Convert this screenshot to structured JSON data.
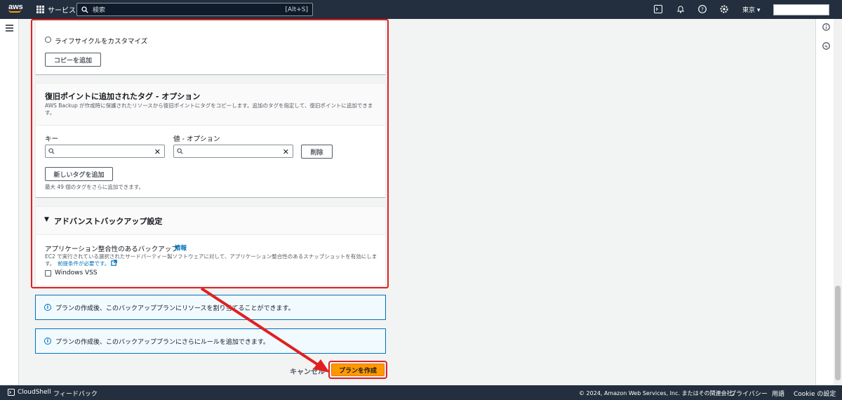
{
  "topnav": {
    "logo": "aws",
    "services_label": "サービス",
    "search_placeholder": "検索",
    "search_shortcut": "[Alt+S]",
    "region": "東京 ▾",
    "icons": [
      "cloudshell-icon",
      "bell-icon",
      "help-icon",
      "settings-icon"
    ]
  },
  "lifecycle": {
    "radio_label": "ライフサイクルをカスタマイズ",
    "add_copy_button": "コピーを追加"
  },
  "tags": {
    "heading": "復旧ポイントに追加されたタグ - オプション",
    "description": "AWS Backup が作成時に保護されたリソースから復旧ポイントにタグをコピーします。追加のタグを指定して、復旧ポイントに追加できま す。",
    "key_label": "キー",
    "value_label": "値 - オプション",
    "key_value": "",
    "value_value": "",
    "remove_button": "削除",
    "add_tag_button": "新しいタグを追加",
    "remaining_note": "最大 49 個のタグをさらに追加できます。"
  },
  "advanced": {
    "heading": "アドバンストバックアップ設定",
    "option_label": "アプリケーション整合性のあるバックアップ",
    "info_link": "情報",
    "description_line1": "EC2 で実行されている選択されたサードパーティー製ソフトウェアに対して、アプリケーション整合性のあるスナップショットを有効にしま",
    "description_line2": "す。",
    "prereq_link": "前提条件が必要です。",
    "checkbox_label": "Windows VSS"
  },
  "alerts": {
    "resources": "プランの作成後、このバックアッププランにリソースを割り当てることができます。",
    "rules": "プランの作成後、このバックアッププランにさらにルールを追加できます。"
  },
  "actions": {
    "cancel": "キャンセル",
    "create": "プランを作成"
  },
  "footer": {
    "cloudshell": "CloudShell",
    "feedback": "フィードバック",
    "copyright": "© 2024, Amazon Web Services, Inc. またはその関連会社。",
    "privacy": "プライバシー",
    "terms": "用語",
    "cookie": "Cookie の設定"
  },
  "colors": {
    "nav_bg": "#232f3e",
    "primary": "#ff9900",
    "link": "#0073bb",
    "highlight": "#e02020"
  }
}
